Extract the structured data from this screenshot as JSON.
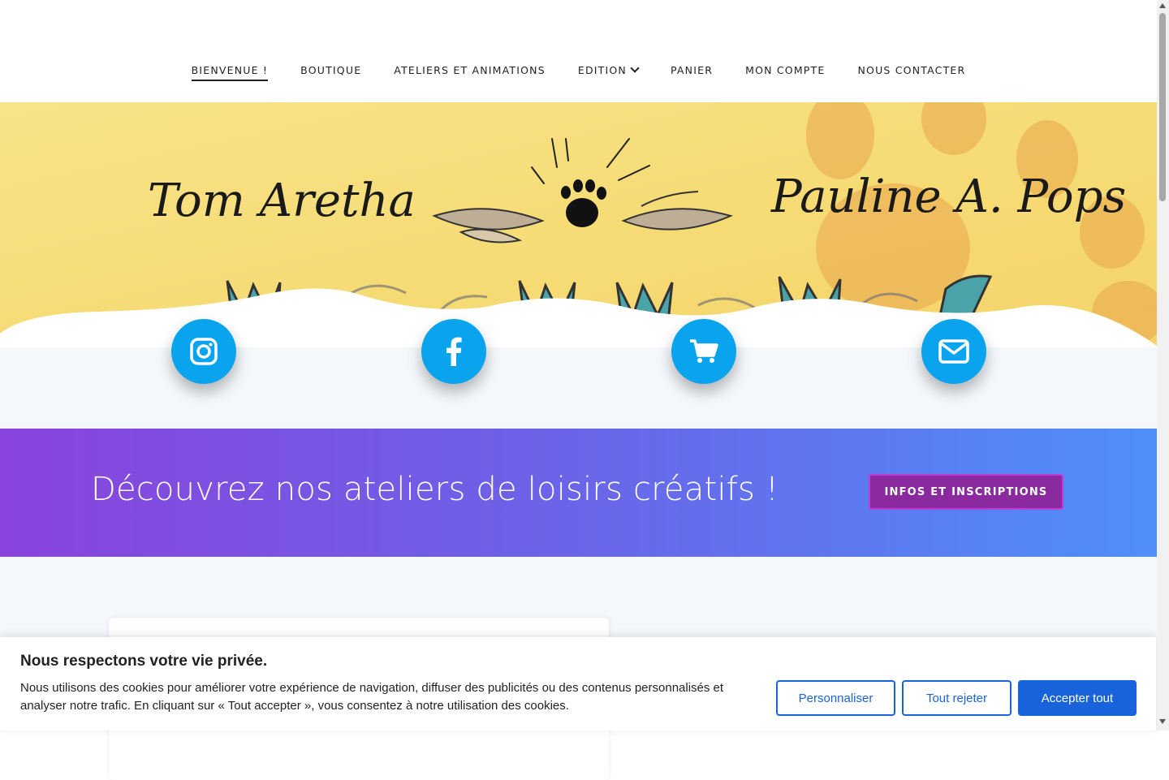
{
  "nav": {
    "items": [
      {
        "label": "BIENVENUE !",
        "active": true
      },
      {
        "label": "BOUTIQUE"
      },
      {
        "label": "ATELIERS ET ANIMATIONS"
      },
      {
        "label": "EDITION",
        "dropdown": true
      },
      {
        "label": "PANIER"
      },
      {
        "label": "MON COMPTE"
      },
      {
        "label": "NOUS CONTACTER"
      }
    ]
  },
  "hero": {
    "left_name": "Tom Aretha",
    "right_name": "Pauline A. Pops",
    "colors": {
      "paper": "#f7dc78",
      "paw": "#e9a64a",
      "ink": "#1a1a1a"
    }
  },
  "social": {
    "buttons": [
      {
        "icon": "instagram-icon"
      },
      {
        "icon": "facebook-icon"
      },
      {
        "icon": "cart-icon"
      },
      {
        "icon": "envelope-icon"
      }
    ],
    "color": "#0aa4ee"
  },
  "banner": {
    "title": "Découvrez nos ateliers de loisirs créatifs !",
    "button": "INFOS ET INSCRIPTIONS"
  },
  "cookie": {
    "title": "Nous respectons votre vie privée.",
    "text": "Nous utilisons des cookies pour améliorer votre expérience de navigation, diffuser des publicités ou des contenus personnalisés et analyser notre trafic. En cliquant sur « Tout accepter », vous consentez à notre utilisation des cookies.",
    "customize": "Personnaliser",
    "reject": "Tout rejeter",
    "accept": "Accepter tout",
    "accent": "#1863dc"
  }
}
